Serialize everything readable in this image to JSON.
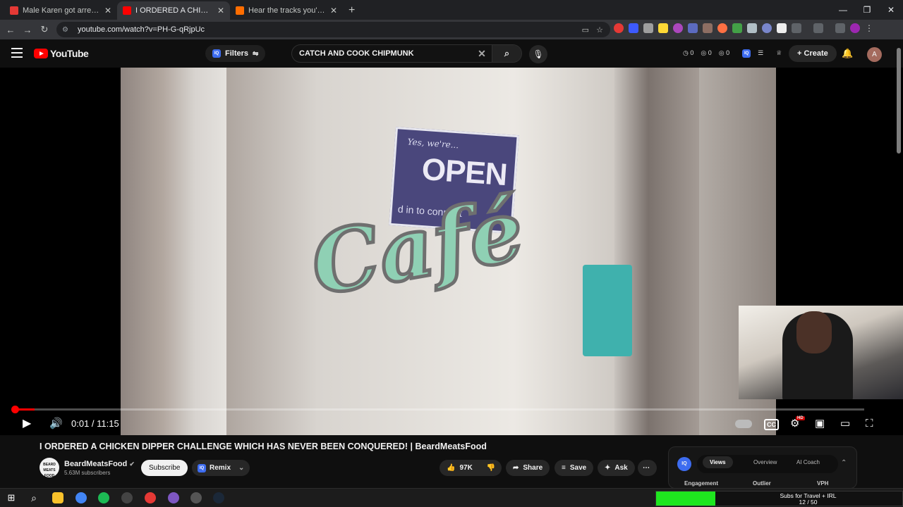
{
  "browser": {
    "tabs": [
      {
        "title": "Male Karen got arrested for the",
        "color": "#e53935"
      },
      {
        "title": "I ORDERED A CHICKEN DIPPER",
        "color": "#ff0000"
      },
      {
        "title": "Hear the tracks you've liked: on",
        "color": "#ff6d00"
      }
    ],
    "new_tab": "+",
    "url": "youtube.com/watch?v=PH-G-qRjpUc"
  },
  "youtube": {
    "logo_text": "YouTube",
    "filters_label": "Filters",
    "search_value": "CATCH AND COOK CHIPMUNK",
    "stats": [
      "0",
      "0",
      "0"
    ],
    "create_label": "Create",
    "avatar_letter": "A"
  },
  "video": {
    "sign_yes": "Yes, we're...",
    "sign_open": "OPEN",
    "sign_sub": "d in to connect",
    "cafe_text": "Café",
    "current_time": "0:01",
    "duration": "11:15",
    "time_display": "0:01 / 11:15",
    "progress_fraction": 0.0015,
    "cc_label": "CC",
    "hd_badge": "HD"
  },
  "meta": {
    "title": "I ORDERED A CHICKEN DIPPER CHALLENGE WHICH HAS NEVER BEEN CONQUERED! | BeardMeatsFood",
    "channel_name": "BeardMeatsFood",
    "channel_avatar_text": "BEARD MEATS FOOD",
    "subscribers": "5.63M subscribers",
    "subscribe_label": "Subscribe",
    "remix_label": "Remix",
    "likes": "97K",
    "share_label": "Share",
    "save_label": "Save",
    "ask_label": "Ask"
  },
  "vidiq": {
    "badge": "IQ",
    "tabs": [
      "Views",
      "Overview",
      "AI Coach"
    ],
    "columns": [
      "Engagement",
      "Outlier",
      "VPH"
    ]
  },
  "taskbar": {
    "subs_label": "Subs for Travel + IRL",
    "subs_count": "12 / 50",
    "subs_fraction": 0.24
  }
}
